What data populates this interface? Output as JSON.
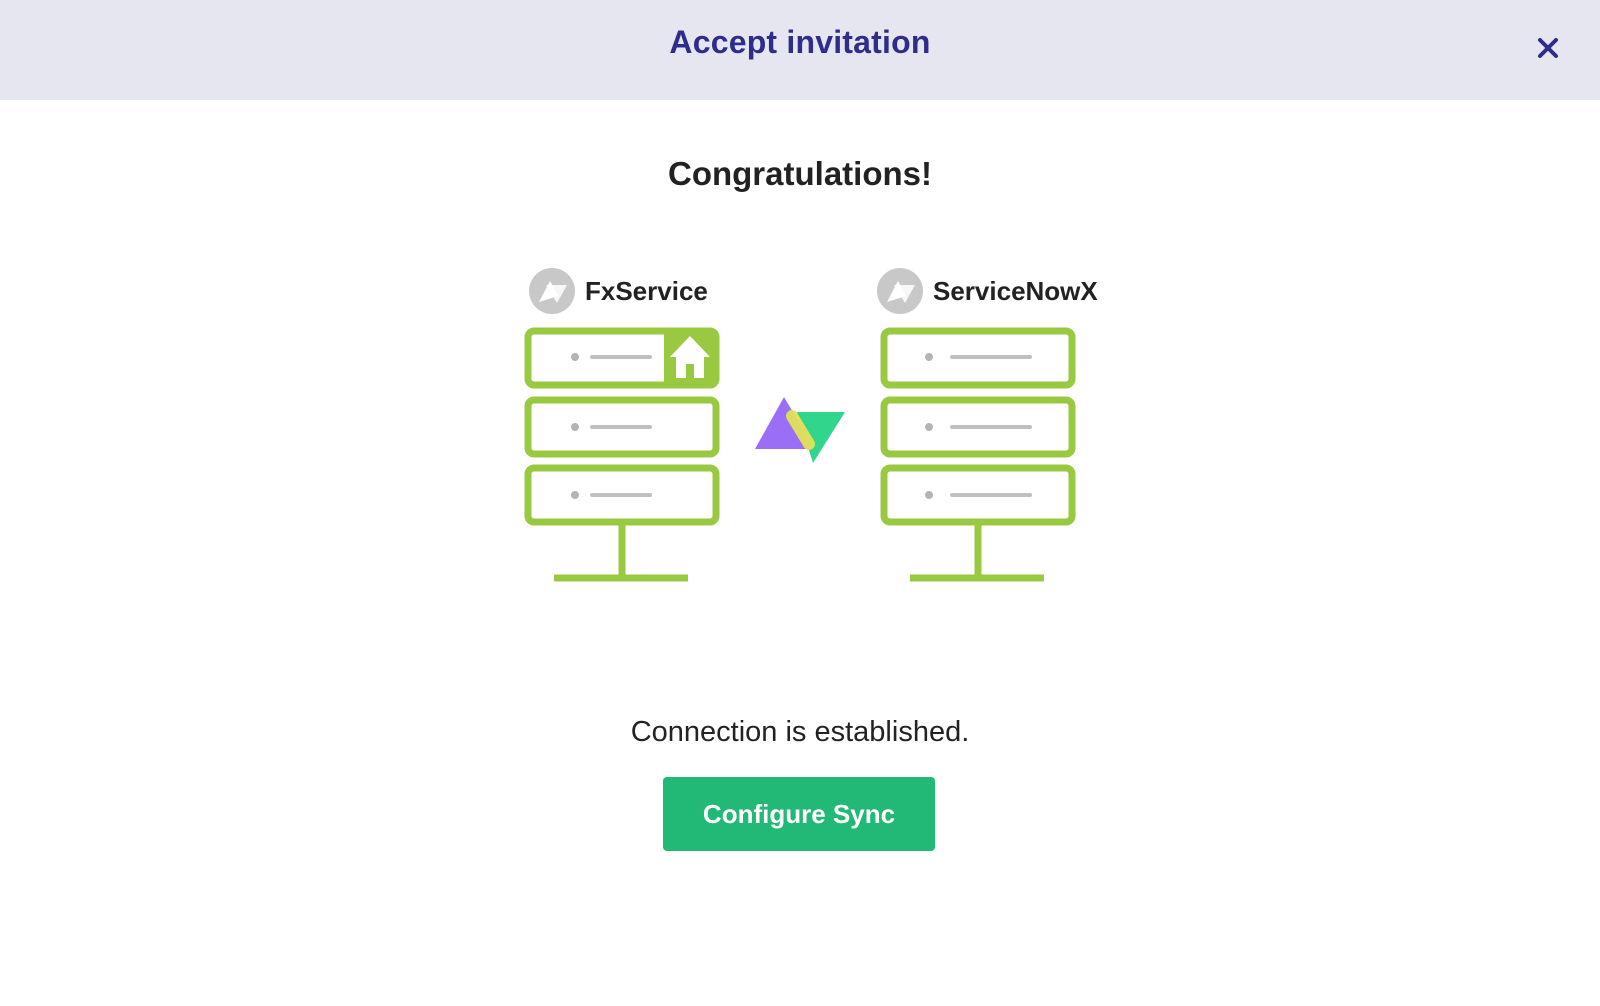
{
  "header": {
    "title": "Accept invitation",
    "close_icon": "close-icon"
  },
  "main": {
    "heading": "Congratulations!",
    "left_instance": {
      "name": "FxService",
      "logo_icon": "exalate-grey-logo-icon",
      "home_icon": "home-icon"
    },
    "right_instance": {
      "name": "ServiceNowX",
      "logo_icon": "exalate-grey-logo-icon"
    },
    "connector_icon": "exalate-logo-icon",
    "status_text": "Connection is established.",
    "primary_button_label": "Configure Sync"
  },
  "colors": {
    "header_bg": "#e6e6f0",
    "title": "#2f2d8c",
    "server_outline": "#98c941",
    "button_bg": "#22b875",
    "logo_purple": "#9a6ef5",
    "logo_green": "#2fd68c",
    "logo_yellow": "#e2e15a"
  }
}
